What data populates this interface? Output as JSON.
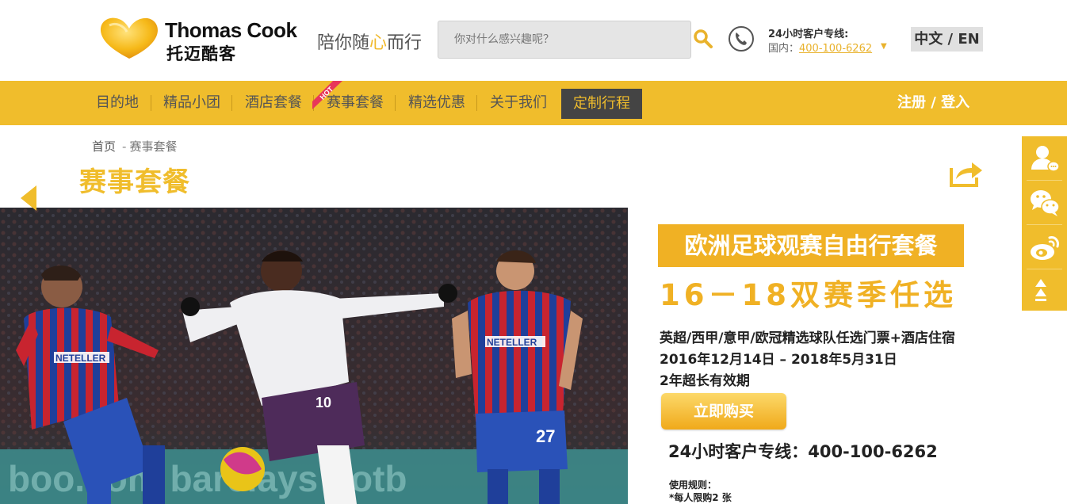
{
  "header": {
    "logo_en": "Thomas Cook",
    "logo_cn": "托迈酷客",
    "slogan_pre": "陪你随",
    "slogan_hl": "心",
    "slogan_post": "而行",
    "search_placeholder": "你对什么感兴趣呢？",
    "hotline_title": "24小时客户专线:",
    "hotline_label": "国内：",
    "hotline_number": "400-100-6262",
    "language": "中文 / EN"
  },
  "nav": {
    "items": [
      {
        "label": "目的地"
      },
      {
        "label": "精品小团"
      },
      {
        "label": "酒店套餐"
      },
      {
        "label": "赛事套餐"
      },
      {
        "label": "精选优惠"
      },
      {
        "label": "关于我们"
      }
    ],
    "active_label": "定制行程",
    "hot_badge": "HOT",
    "register": "注册",
    "slash": "/",
    "login": "登入"
  },
  "breadcrumb": {
    "home": "首页",
    "sep": "-",
    "current": "赛事套餐"
  },
  "page_title": "赛事套餐",
  "banner": {
    "headline": "欧洲足球观赛自由行套餐",
    "subheadline": "16－18双赛季任选",
    "description": "英超/西甲/意甲/欧冠精选球队任选门票+酒店住宿",
    "date_range": "2016年12月14日 – 2018年5月31日",
    "validity": "2年超长有效期",
    "buy_button": "立即购买",
    "hotline": "24小时客户专线：400-100-6262",
    "rules_title": "使用规则：",
    "rules_item": "*每人限购2 张",
    "photo_sponsor": "NETELLER",
    "jersey_number_1": "10",
    "jersey_number_2": "27"
  },
  "colors": {
    "brand_yellow": "#f0bd2c",
    "dark_nav": "#444444",
    "promo_orange": "#f0b124"
  },
  "sidebar": {
    "icons": [
      "customer-service-icon",
      "wechat-icon",
      "weibo-icon",
      "back-to-top-icon"
    ]
  }
}
